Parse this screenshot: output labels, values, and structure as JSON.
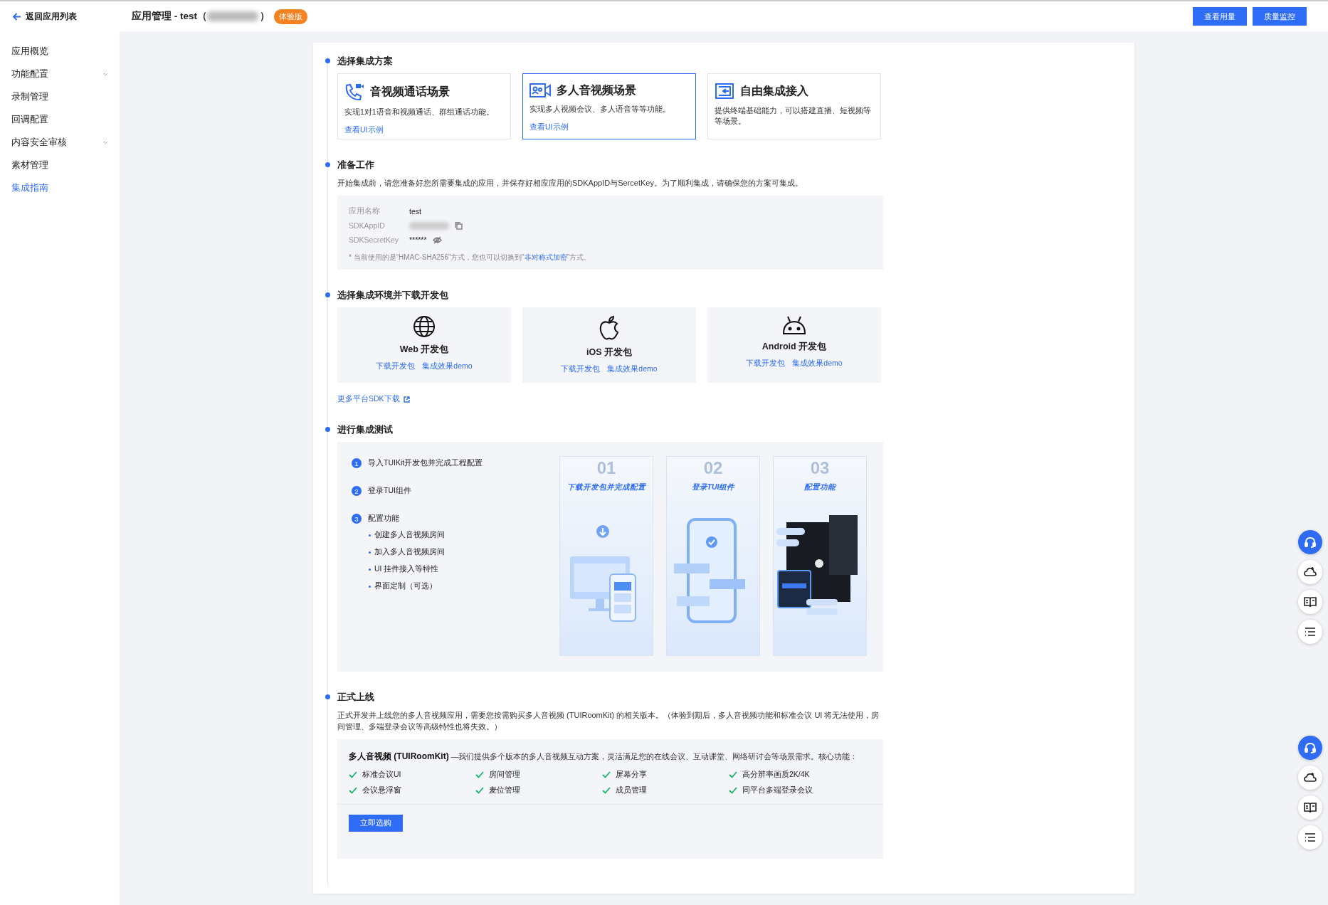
{
  "header": {
    "back_label": "返回应用列表",
    "title": "应用管理 - test（",
    "title_end": "）",
    "badge": "体验版",
    "buttons": [
      "查看用量",
      "质量监控"
    ]
  },
  "sidebar": {
    "items": [
      {
        "label": "应用概览",
        "expandable": false,
        "selected": false
      },
      {
        "label": "功能配置",
        "expandable": true,
        "selected": false
      },
      {
        "label": "录制管理",
        "expandable": false,
        "selected": false
      },
      {
        "label": "回调配置",
        "expandable": false,
        "selected": false
      },
      {
        "label": "内容安全审核",
        "expandable": true,
        "selected": false
      },
      {
        "label": "素材管理",
        "expandable": false,
        "selected": false
      },
      {
        "label": "集成指南",
        "expandable": false,
        "selected": true
      }
    ]
  },
  "sections": [
    {
      "kind": "schemes",
      "title": "选择集成方案",
      "cards": [
        {
          "kind": "call",
          "title": "音视频通话场景",
          "desc": "实现1对1语音和视频通话、群组通话功能。",
          "link": "查看UI示例",
          "selected": false
        },
        {
          "kind": "room",
          "title": "多人音视频场景",
          "desc": "实现多人视频会议、多人语音等等功能。",
          "link": "查看UI示例",
          "selected": true
        },
        {
          "kind": "custom",
          "title": "自由集成接入",
          "desc": "提供终端基础能力，可以搭建直播、短视频等等场景。",
          "selected": false
        }
      ]
    },
    {
      "kind": "prepare",
      "title": "准备工作",
      "desc": "开始集成前，请您准备好您所需要集成的应用，并保存好相应应用的SDKAppID与SercetKey。为了顺利集成，请确保您的方案可集成。",
      "rows": [
        {
          "kind": "text",
          "label": "应用名称",
          "value": "test"
        },
        {
          "kind": "copy",
          "label": "SDKAppID"
        },
        {
          "kind": "secret",
          "label": "SDKSecretKey",
          "value": "******"
        }
      ],
      "note": {
        "before": "* 当前使用的是“HMAC-SHA256”方式，您也可以切换到“",
        "link": "非对称式加密",
        "after": "”方式。"
      }
    },
    {
      "kind": "platforms",
      "title": "选择集成环境并下载开发包",
      "platforms": [
        {
          "kind": "web",
          "name": "Web 开发包",
          "links": [
            "下载开发包",
            "集成效果demo"
          ]
        },
        {
          "kind": "ios",
          "name": "iOS 开发包",
          "links": [
            "下载开发包",
            "集成效果demo"
          ]
        },
        {
          "kind": "android",
          "name": "Android 开发包",
          "links": [
            "下载开发包",
            "集成效果demo"
          ]
        }
      ],
      "more_link": "更多平台SDK下载"
    },
    {
      "kind": "test",
      "title": "进行集成测试",
      "steps": [
        {
          "number": "1",
          "label": "导入TUIKit开发包并完成工程配置"
        },
        {
          "number": "2",
          "label": "登录TUI组件"
        },
        {
          "number": "3",
          "label": "配置功能",
          "bullets": [
            "创建多人音视频房间",
            "加入多人音视频房间",
            "UI 挂件接入等特性",
            "界面定制（可选）"
          ]
        }
      ],
      "panels": [
        {
          "kind": "download",
          "number": "01",
          "title": "下载开发包并完成配置"
        },
        {
          "kind": "login",
          "number": "02",
          "title": "登录TUI组件"
        },
        {
          "kind": "configure",
          "number": "03",
          "title": "配置功能"
        }
      ]
    },
    {
      "kind": "launch",
      "title": "正式上线",
      "desc": "正式开发并上线您的多人音视频应用，需要您按需购买多人音视频 (TUIRoomKit) 的相关版本。（体验到期后，多人音视频功能和标准会议 UI 将无法使用，房间管理、多端登录会议等高级特性也将失效。）",
      "product": {
        "name": "多人音视频 (TUIRoomKit)",
        "desc": "—我们提供多个版本的多人音视频互动方案，灵活满足您的在线会议、互动课堂、网络研讨会等场景需求。核心功能："
      },
      "features": [
        "标准会议UI",
        "房间管理",
        "屏幕分享",
        "高分辨率画质2K/4K",
        "会议悬浮窗",
        "麦位管理",
        "成员管理",
        "同平台多端登录会议"
      ],
      "button": "立即选购"
    }
  ],
  "floating_toolbars": [
    {
      "tools": [
        {
          "kind": "headset"
        },
        {
          "kind": "cloud"
        },
        {
          "kind": "book"
        },
        {
          "kind": "list"
        }
      ]
    },
    {
      "tools": [
        {
          "kind": "headset"
        },
        {
          "kind": "cloud"
        },
        {
          "kind": "book"
        },
        {
          "kind": "list"
        }
      ]
    }
  ]
}
